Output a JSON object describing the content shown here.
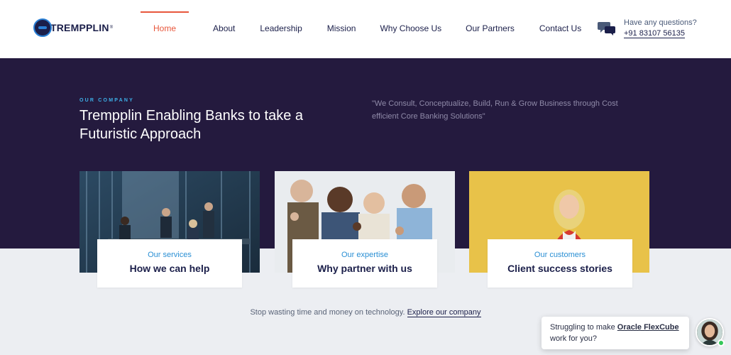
{
  "header": {
    "logo": {
      "text": "TREMPPLIN",
      "tm": "®"
    },
    "nav": [
      {
        "label": "Home",
        "active": true
      },
      {
        "label": "About",
        "active": false
      },
      {
        "label": "Leadership",
        "active": false
      },
      {
        "label": "Mission",
        "active": false
      },
      {
        "label": "Why Choose Us",
        "active": false
      },
      {
        "label": "Our Partners",
        "active": false
      },
      {
        "label": "Contact Us",
        "active": false
      }
    ],
    "contact": {
      "question": "Have any questions?",
      "phone": "+91 83107 56135"
    }
  },
  "hero": {
    "eyebrow": "OUR COMPANY",
    "title": "Trempplin Enabling Banks to take a Futuristic Approach",
    "quote": "\"We Consult, Conceptualize, Build, Run & Grow Business through Cost efficient Core Banking Solutions\""
  },
  "cards": [
    {
      "subtitle": "Our services",
      "title": "How we can help"
    },
    {
      "subtitle": "Our expertise",
      "title": "Why partner with us"
    },
    {
      "subtitle": "Our customers",
      "title": "Client success stories"
    }
  ],
  "footer": {
    "text": "Stop wasting time and money on technology.",
    "link": "Explore our company"
  },
  "chat": {
    "prefix": "Struggling to make",
    "product": "Oracle FlexCube",
    "suffix": "work for you?"
  },
  "colors": {
    "hero_bg": "#241a3e",
    "accent": "#e8573c",
    "link_blue": "#2a8fd4",
    "navy": "#1b1f4a"
  }
}
